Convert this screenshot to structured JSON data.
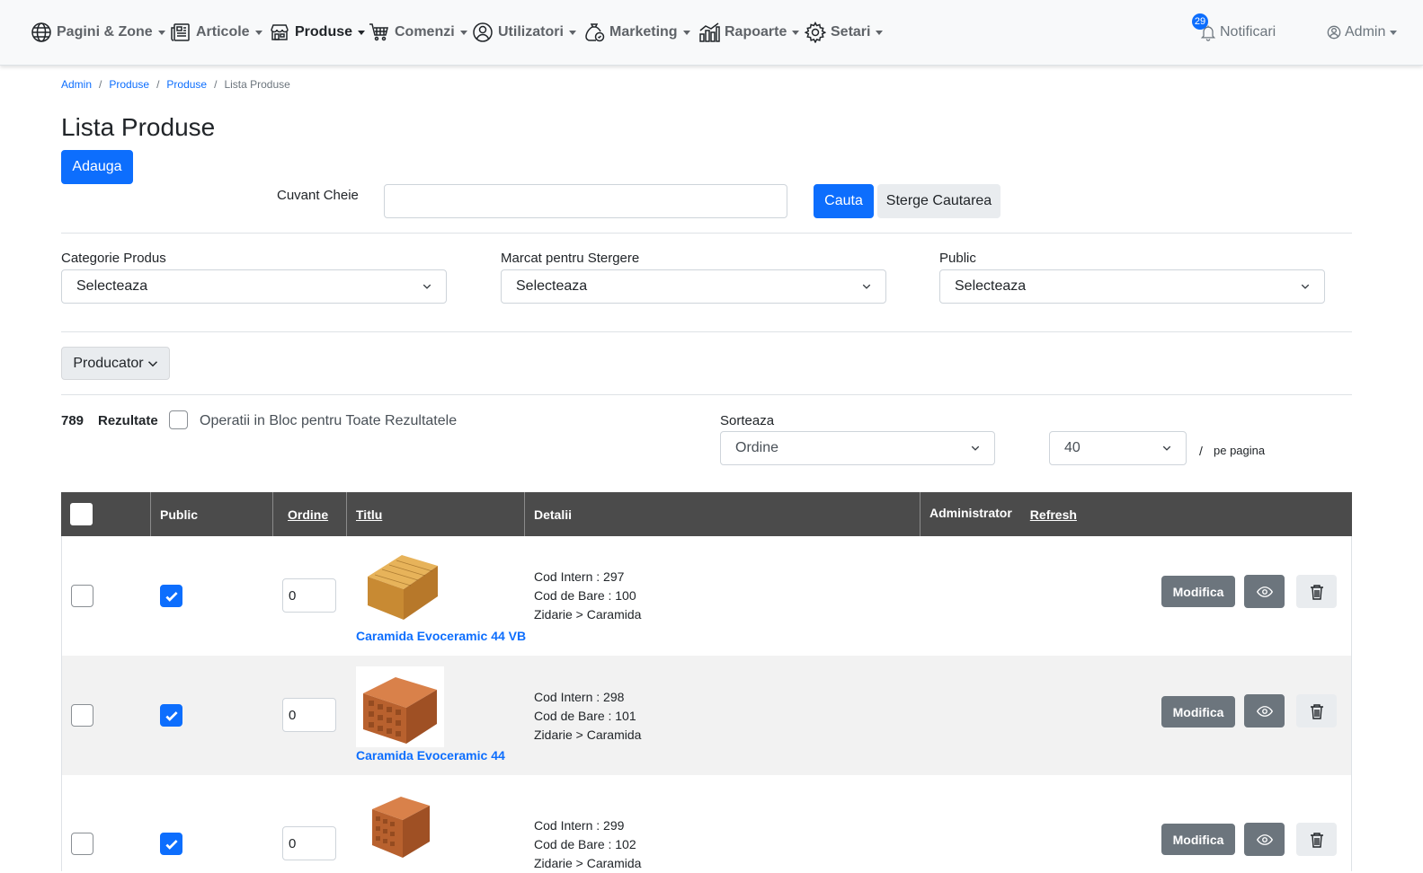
{
  "nav": {
    "items": [
      {
        "label": "Pagini & Zone",
        "icon": "globe-icon"
      },
      {
        "label": "Articole",
        "icon": "newspaper-icon"
      },
      {
        "label": "Produse",
        "icon": "shop-icon"
      },
      {
        "label": "Comenzi",
        "icon": "cart-icon"
      },
      {
        "label": "Utilizatori",
        "icon": "user-circle-icon"
      },
      {
        "label": "Marketing",
        "icon": "money-bag-icon"
      },
      {
        "label": "Rapoarte",
        "icon": "chart-icon"
      },
      {
        "label": "Setari",
        "icon": "gear-icon"
      }
    ],
    "notifications": {
      "label": "Notificari",
      "count": "29"
    },
    "admin": {
      "label": "Admin"
    }
  },
  "breadcrumb": [
    "Admin",
    "Produse",
    "Produse",
    "Lista Produse"
  ],
  "page": {
    "title": "Lista Produse",
    "add_button": "Adauga"
  },
  "search": {
    "label": "Cuvant Cheie",
    "value": "",
    "search_button": "Cauta",
    "clear_button": "Sterge Cautarea"
  },
  "filters": {
    "category": {
      "label": "Categorie Produs",
      "selected": "Selecteaza"
    },
    "marked_delete": {
      "label": "Marcat pentru Stergere",
      "selected": "Selecteaza"
    },
    "public": {
      "label": "Public",
      "selected": "Selecteaza"
    },
    "producer_button": "Producator"
  },
  "results": {
    "count": "789",
    "label": "Rezultate",
    "bulk_label": "Operatii in Bloc pentru Toate Rezultatele",
    "sort_label": "Sorteaza",
    "sort_selected": "Ordine",
    "per_page_selected": "40",
    "per_page_sep": "/",
    "per_page_label": "pe pagina"
  },
  "table": {
    "headers": {
      "public": "Public",
      "order": "Ordine",
      "title": "Titlu",
      "details": "Detalii",
      "admin": "Administrator",
      "refresh": "Refresh"
    },
    "rows": [
      {
        "public": true,
        "order": "0",
        "title": "Caramida Evoceramic 44 VB",
        "details": [
          "Cod Intern : 297",
          "Cod de Bare : 100",
          "Zidarie > Caramida"
        ],
        "edit": "Modifica"
      },
      {
        "public": true,
        "order": "0",
        "title": "Caramida Evoceramic 44",
        "details": [
          "Cod Intern : 298",
          "Cod de Bare : 101",
          "Zidarie > Caramida"
        ],
        "edit": "Modifica"
      },
      {
        "public": true,
        "order": "0",
        "title": "",
        "details": [
          "Cod Intern : 299",
          "Cod de Bare : 102",
          "Zidarie > Caramida"
        ],
        "edit": "Modifica"
      }
    ]
  },
  "colors": {
    "primary": "#0d6efd",
    "header_bg": "#4b4b4b",
    "secondary": "#6c757d"
  }
}
